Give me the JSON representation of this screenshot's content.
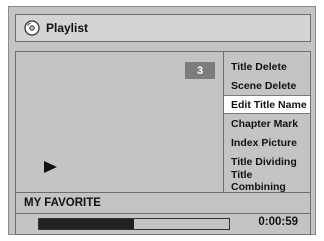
{
  "header": {
    "title": "Playlist",
    "icon": "disc-icon"
  },
  "preview": {
    "title_number": "3",
    "state_icon": "play-icon"
  },
  "menu": {
    "items": [
      {
        "label": "Title Delete"
      },
      {
        "label": "Scene Delete"
      },
      {
        "label": "Edit Title Name"
      },
      {
        "label": "Chapter Mark"
      },
      {
        "label": "Index Picture"
      },
      {
        "label": "Title Dividing"
      },
      {
        "label": "Title Combining"
      }
    ],
    "selected": "Edit Title Name"
  },
  "title_name": "MY FAVORITE",
  "playback": {
    "progress": 0.5,
    "time": "0:00:59"
  }
}
